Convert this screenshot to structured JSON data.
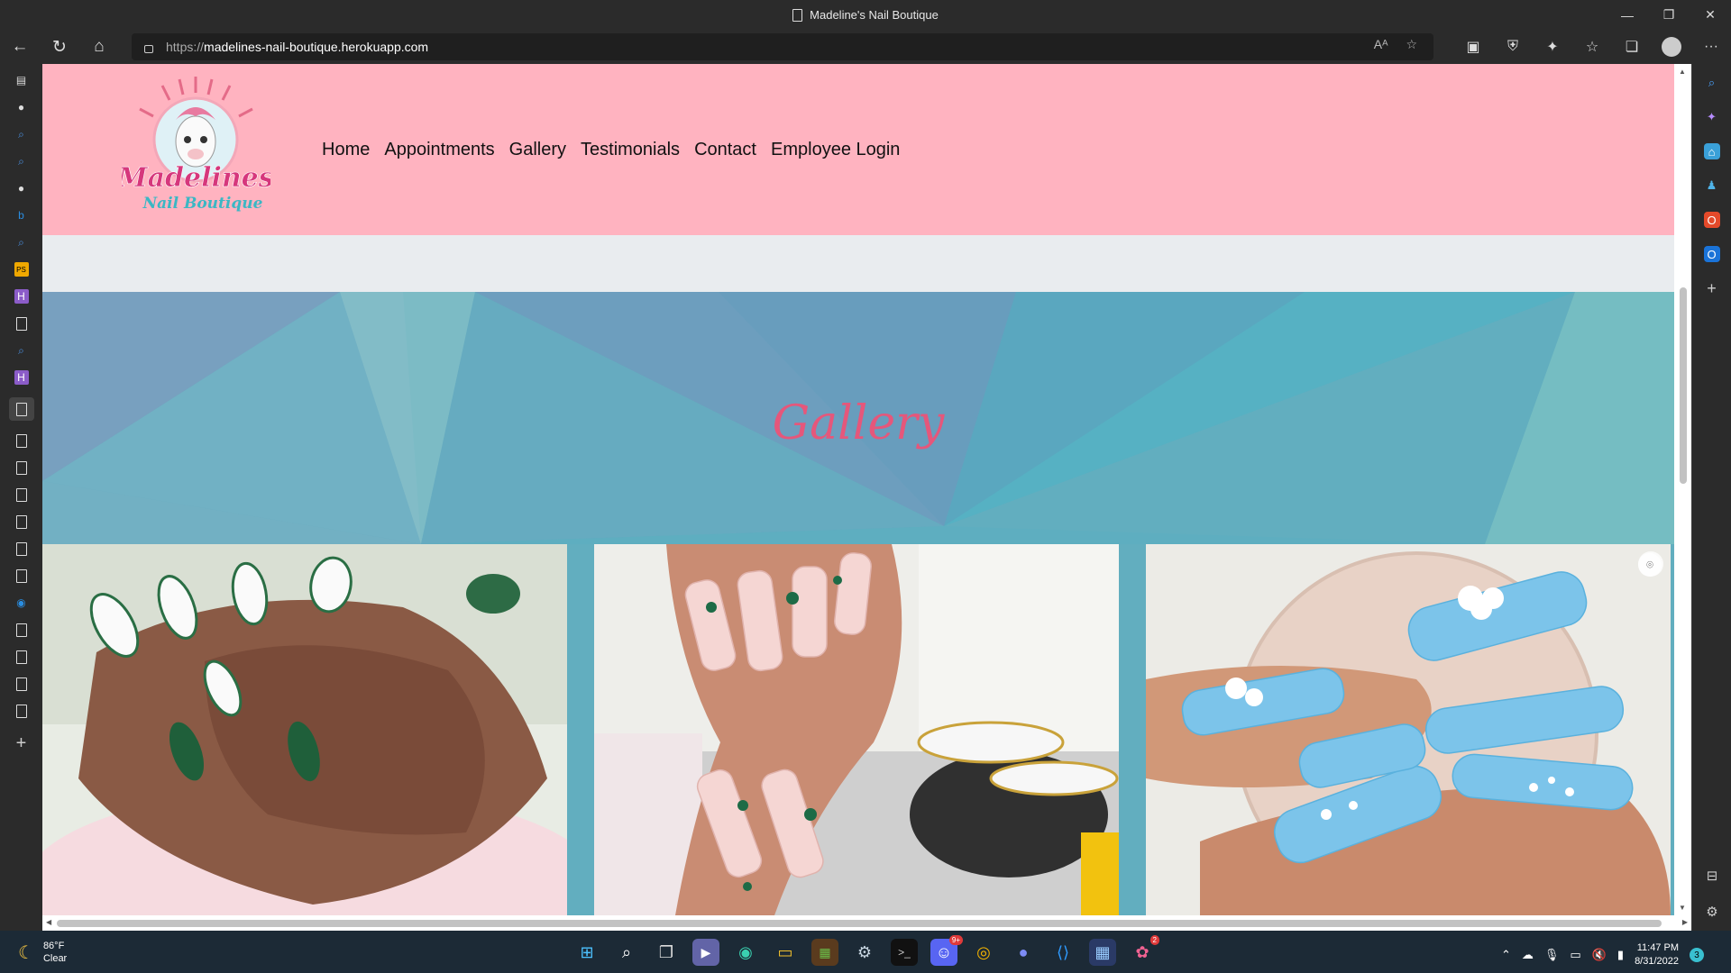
{
  "window": {
    "title": "Madeline's Nail Boutique",
    "controls": {
      "minimize": "—",
      "restore": "❐",
      "close": "✕"
    }
  },
  "toolbar": {
    "url_scheme": "https://",
    "url_host": "madelines-nail-boutique.herokuapp.com"
  },
  "site": {
    "logo_text_main": "Madelines",
    "logo_text_sub": "Nail Boutique",
    "nav": [
      "Home",
      "Appointments",
      "Gallery",
      "Testimonials",
      "Contact",
      "Employee Login"
    ],
    "gallery_title": "Gallery"
  },
  "colors": {
    "header_bg": "#ffb3c0",
    "band_bg": "#e9ecef",
    "gallery_bg": "#62aebf",
    "accent_pink": "#e5577b"
  },
  "taskbar": {
    "weather_temp": "86°F",
    "weather_cond": "Clear",
    "time": "11:47 PM",
    "date": "8/31/2022",
    "notification_count": "3",
    "discord_badge": "9+",
    "app_badge": "2"
  }
}
